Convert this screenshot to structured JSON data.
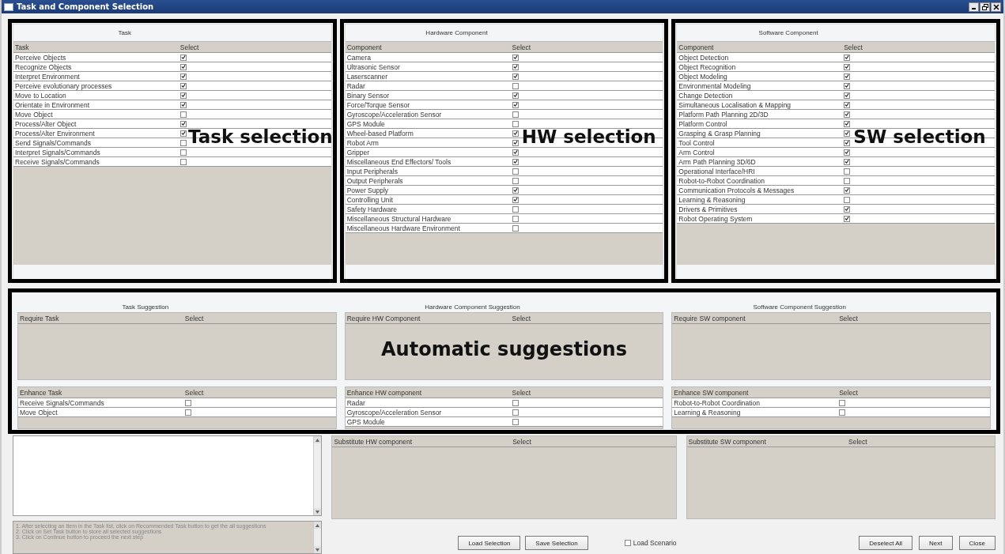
{
  "window": {
    "title": "Task and Component Selection"
  },
  "selection_panels": [
    {
      "title": "Task",
      "annotation": "Task selection",
      "columns": [
        "Task",
        "Select"
      ],
      "rows": [
        {
          "label": "Perceive Objects",
          "checked": true
        },
        {
          "label": "Recognize Objects",
          "checked": true
        },
        {
          "label": "Interpret Environment",
          "checked": true
        },
        {
          "label": "Perceive evolutionary processes",
          "checked": true
        },
        {
          "label": "Move to Location",
          "checked": true
        },
        {
          "label": "Orientate in Environment",
          "checked": true
        },
        {
          "label": "Move Object",
          "checked": false
        },
        {
          "label": "Process/Alter Object",
          "checked": true
        },
        {
          "label": "Process/Alter Environment",
          "checked": true
        },
        {
          "label": "Send Signals/Commands",
          "checked": false
        },
        {
          "label": "Interpret Signals/Commands",
          "checked": false
        },
        {
          "label": "Receive Signals/Commands",
          "checked": false
        }
      ]
    },
    {
      "title": "Hardware Component",
      "annotation": "HW selection",
      "columns": [
        "Component",
        "Select"
      ],
      "rows": [
        {
          "label": "Camera",
          "checked": true
        },
        {
          "label": "Ultrasonic Sensor",
          "checked": true
        },
        {
          "label": "Laserscanner",
          "checked": true
        },
        {
          "label": "Radar",
          "checked": false
        },
        {
          "label": "Binary Sensor",
          "checked": true
        },
        {
          "label": "Force/Torque Sensor",
          "checked": true
        },
        {
          "label": "Gyroscope/Acceleration Sensor",
          "checked": false
        },
        {
          "label": "GPS Module",
          "checked": false
        },
        {
          "label": "Wheel-based Platform",
          "checked": true
        },
        {
          "label": "Robot Arm",
          "checked": true
        },
        {
          "label": "Gripper",
          "checked": true
        },
        {
          "label": "Miscellaneous End Effectors/ Tools",
          "checked": true
        },
        {
          "label": "Input Peripherals",
          "checked": false
        },
        {
          "label": "Output Peripherals",
          "checked": false
        },
        {
          "label": "Power Supply",
          "checked": true
        },
        {
          "label": "Controlling Unit",
          "checked": true
        },
        {
          "label": "Safety Hardware",
          "checked": false
        },
        {
          "label": "Miscellaneous Structural Hardware",
          "checked": false
        },
        {
          "label": "Miscellaneous Hardware Environment",
          "checked": false
        }
      ]
    },
    {
      "title": "Software Component",
      "annotation": "SW selection",
      "columns": [
        "Component",
        "Select"
      ],
      "rows": [
        {
          "label": "Object Detection",
          "checked": true
        },
        {
          "label": "Object Recognition",
          "checked": true
        },
        {
          "label": "Object Modeling",
          "checked": true
        },
        {
          "label": "Environmental Modeling",
          "checked": true
        },
        {
          "label": "Change Detection",
          "checked": true
        },
        {
          "label": "Simultaneous Localisation & Mapping",
          "checked": true
        },
        {
          "label": "Platform Path Planning 2D/3D",
          "checked": true
        },
        {
          "label": "Platform Control",
          "checked": true
        },
        {
          "label": "Grasping & Grasp Planning",
          "checked": true
        },
        {
          "label": "Tool Control",
          "checked": true
        },
        {
          "label": "Arm Control",
          "checked": true
        },
        {
          "label": "Arm Path Planning 3D/6D",
          "checked": true
        },
        {
          "label": "Operational Interface/HRI",
          "checked": false
        },
        {
          "label": "Robot-to-Robot Coordination",
          "checked": false
        },
        {
          "label": "Communication Protocols & Messages",
          "checked": true
        },
        {
          "label": "Learning & Reasoning",
          "checked": false
        },
        {
          "label": "Drivers & Primitives",
          "checked": true
        },
        {
          "label": "Robot Operating System",
          "checked": true
        }
      ]
    }
  ],
  "suggestions": {
    "annotation": "Automatic suggestions",
    "panels": [
      {
        "title": "Task Suggestion",
        "require": {
          "columns": [
            "Require Task",
            "Select"
          ]
        },
        "enhance": {
          "columns": [
            "Enhance Task",
            "Select"
          ],
          "rows": [
            {
              "label": "Receive Signals/Commands",
              "checked": false
            },
            {
              "label": "Move Object",
              "checked": false
            }
          ]
        }
      },
      {
        "title": "Hardware Component Suggestion",
        "require": {
          "columns": [
            "Require HW Component",
            "Select"
          ]
        },
        "enhance": {
          "columns": [
            "Enhance HW component",
            "Select"
          ],
          "rows": [
            {
              "label": "Radar",
              "checked": false
            },
            {
              "label": "Gyroscope/Acceleration Sensor",
              "checked": false
            },
            {
              "label": "GPS Module",
              "checked": false
            }
          ]
        }
      },
      {
        "title": "Software Component Suggestion",
        "require": {
          "columns": [
            "Require SW component",
            "Select"
          ]
        },
        "enhance": {
          "columns": [
            "Enhance SW component",
            "Select"
          ],
          "rows": [
            {
              "label": "Robot-to-Robot Coordination",
              "checked": false
            },
            {
              "label": "Learning & Reasoning",
              "checked": false
            }
          ]
        }
      }
    ]
  },
  "instructions": [
    "1. After selecting an Item in the Task list, click on Recommended Task button to get the all suggestions",
    "2. Click on Set Task button to store all selected suggestions",
    "3. Click on Continue button to proceed the next step"
  ],
  "substitute_panels": [
    {
      "columns": [
        "Substitute HW component",
        "Select"
      ]
    },
    {
      "columns": [
        "Substitute SW component",
        "Select"
      ]
    }
  ],
  "selection_buttons": [
    "Load Selection",
    "Save Selection"
  ],
  "load_scenario": {
    "label": "Load Scenario",
    "checked": false
  },
  "action_buttons": [
    "Deselect All",
    "Next",
    "Close"
  ]
}
